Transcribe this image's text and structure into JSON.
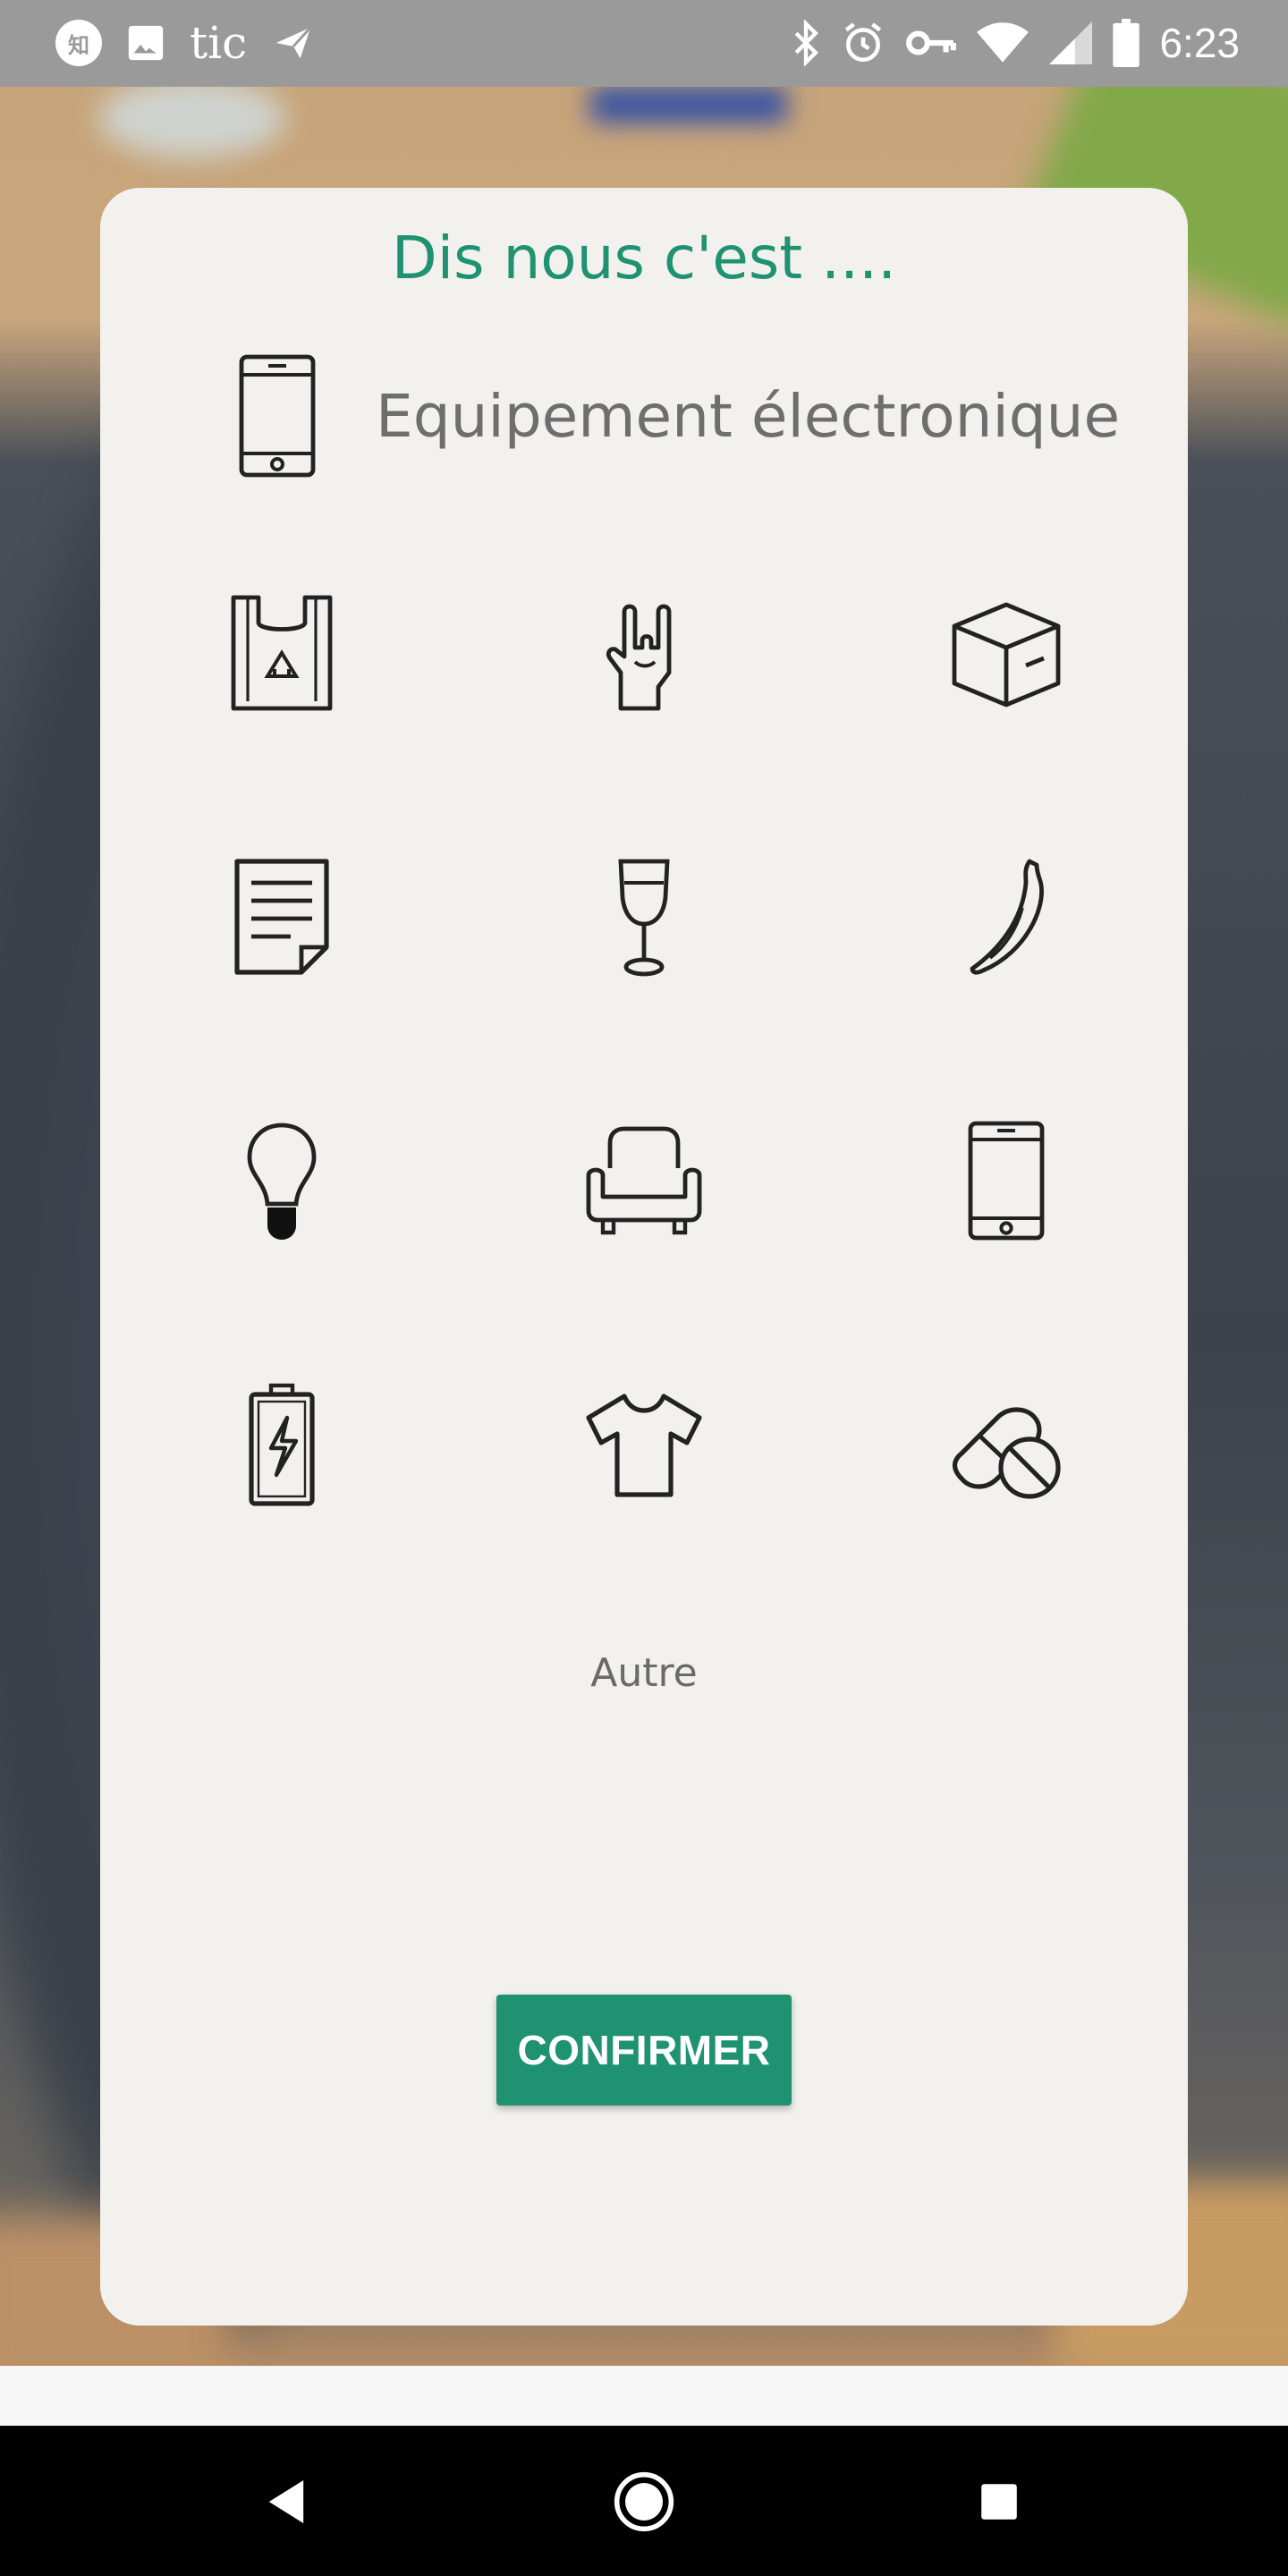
{
  "status_bar": {
    "notif_zhihu": "知",
    "app_label": "tic",
    "time": "6:23",
    "icons": [
      "zhihu-icon",
      "image-icon",
      "send-icon",
      "bluetooth-icon",
      "alarm-icon",
      "vpn-key-icon",
      "wifi-icon",
      "signal-icon",
      "battery-icon"
    ]
  },
  "dialog": {
    "title": "Dis nous c'est ....",
    "selected_label": "Equipement électronique",
    "selected_icon": "smartphone-icon",
    "categories": [
      {
        "icon": "recycling-bag-icon"
      },
      {
        "icon": "rock-hand-icon"
      },
      {
        "icon": "cardboard-box-icon"
      },
      {
        "icon": "paper-document-icon"
      },
      {
        "icon": "wine-glass-icon"
      },
      {
        "icon": "banana-icon"
      },
      {
        "icon": "light-bulb-icon"
      },
      {
        "icon": "armchair-icon"
      },
      {
        "icon": "smartphone-icon"
      },
      {
        "icon": "battery-icon"
      },
      {
        "icon": "t-shirt-icon"
      },
      {
        "icon": "pills-icon"
      }
    ],
    "other_label": "Autre",
    "confirm_label": "CONFIRMER"
  },
  "colors": {
    "accent": "#1f9271",
    "card_bg": "#f2f1ed",
    "text_gray": "#6e6e6e"
  },
  "nav_bar": {
    "icons": [
      "back-icon",
      "home-icon",
      "recents-icon"
    ]
  }
}
